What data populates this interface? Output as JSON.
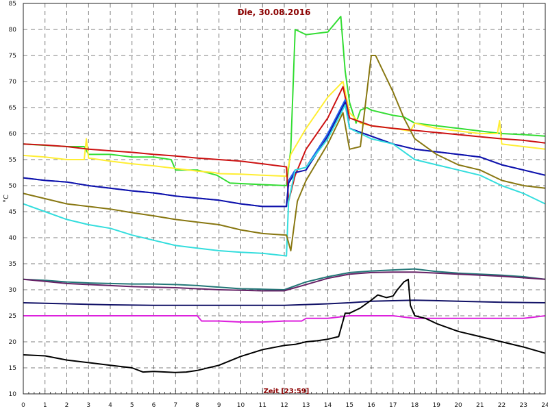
{
  "chart_data": {
    "type": "line",
    "title": "Die, 30.08.2016",
    "xlabel": "Zeit [23:59]",
    "ylabel": "°C",
    "xlim": [
      0,
      24
    ],
    "ylim": [
      10,
      85
    ],
    "xticks": [
      "0",
      "1",
      "2",
      "3",
      "4",
      "5",
      "6",
      "7",
      "8",
      "9",
      "10",
      "11",
      "12",
      "13",
      "14",
      "15",
      "16",
      "17",
      "18",
      "19",
      "20",
      "21",
      "22",
      "23",
      "24"
    ],
    "yticks": [
      "10",
      "15",
      "20",
      "25",
      "30",
      "35",
      "40",
      "45",
      "50",
      "55",
      "60",
      "65",
      "70",
      "75",
      "80",
      "85"
    ],
    "grid": true,
    "legend": "none",
    "series": [
      {
        "color": "#33dd33",
        "x": [
          0,
          2,
          2.8,
          3,
          4,
          5,
          6,
          6.8,
          7,
          8,
          8.9,
          9.5,
          11,
          12.1,
          12.3,
          12.5,
          13,
          14,
          14.6,
          14.8,
          15,
          15.3,
          15.5,
          15.8,
          16,
          17,
          17.5,
          18,
          19,
          20,
          21,
          22,
          23,
          24
        ],
        "y": [
          58,
          57.5,
          57.5,
          56,
          56,
          55.5,
          55.5,
          55,
          53,
          53,
          52,
          50.5,
          50.2,
          50,
          57,
          80,
          79,
          79.5,
          82.5,
          72,
          66,
          62,
          64.5,
          65,
          64.5,
          63.5,
          63.2,
          62,
          61.5,
          61,
          60.5,
          60,
          59.8,
          59.5
        ]
      },
      {
        "color": "#ffee33",
        "x": [
          0,
          1,
          2,
          2.8,
          2.9,
          3,
          4,
          5,
          6,
          7,
          8,
          8.8,
          9,
          10,
          11,
          12.1,
          12.3,
          13,
          14,
          14.7,
          15,
          15.5,
          16,
          17,
          17.8,
          18,
          19,
          20,
          21,
          21.8,
          21.9,
          22,
          23,
          24
        ],
        "y": [
          55.8,
          55.5,
          55,
          55,
          59,
          55.3,
          54.7,
          54.2,
          53.8,
          53.3,
          52.8,
          52.5,
          52.3,
          52.2,
          52,
          51.8,
          56,
          61,
          67,
          70,
          64,
          62,
          61.5,
          61,
          60.5,
          62,
          61,
          60.5,
          60,
          60,
          62.5,
          58,
          57.5,
          57
        ]
      },
      {
        "color": "#cc1111",
        "x": [
          0,
          1,
          2,
          3,
          4,
          5,
          6,
          7,
          8,
          9,
          10,
          11,
          12.1,
          12.2,
          12.5,
          13,
          14,
          14.7,
          15,
          16,
          17,
          18,
          19,
          20,
          21,
          22,
          23,
          24
        ],
        "y": [
          58,
          57.8,
          57.5,
          57,
          56.7,
          56.4,
          56,
          55.7,
          55.3,
          55,
          54.7,
          54.2,
          53.6,
          47,
          52,
          57,
          63,
          69,
          63,
          61.5,
          61,
          60.6,
          60.2,
          59.8,
          59.4,
          59,
          58.7,
          58.2
        ]
      },
      {
        "color": "#2266ee",
        "x": [
          0,
          1,
          2,
          3,
          4,
          5,
          6,
          7,
          8,
          9,
          10,
          11,
          12.1,
          12.2,
          12.5,
          13,
          14,
          14.8,
          15,
          16,
          17,
          18,
          19,
          20,
          21,
          22,
          23,
          24
        ],
        "y": [
          51.5,
          51,
          50.7,
          50,
          49.5,
          49,
          48.6,
          48,
          47.6,
          47.2,
          46.5,
          46,
          46,
          51,
          53,
          53.5,
          60,
          66.5,
          61,
          59.5,
          58,
          57,
          56.5,
          56,
          55.5,
          54,
          53,
          52
        ]
      },
      {
        "color": "#1111aa",
        "x": [
          0,
          1,
          2,
          3,
          4,
          5,
          6,
          7,
          8,
          9,
          10,
          11,
          12.1,
          12.2,
          12.5,
          13,
          14,
          14.8,
          15,
          16,
          17,
          18,
          19,
          20,
          21,
          22,
          23,
          24
        ],
        "y": [
          51.5,
          51,
          50.7,
          50,
          49.5,
          49,
          48.6,
          48,
          47.6,
          47.2,
          46.5,
          46,
          46,
          50.5,
          52.5,
          53,
          59.5,
          66,
          61,
          59.5,
          58,
          57,
          56.5,
          56,
          55.5,
          54,
          53,
          52
        ]
      },
      {
        "color": "#33dddd",
        "x": [
          0,
          1,
          2,
          3,
          4,
          5,
          6,
          7,
          8,
          9,
          10,
          11,
          12.1,
          12.2,
          12.5,
          13,
          14,
          14.8,
          15,
          16,
          17,
          17.5,
          18,
          19,
          20,
          21,
          22,
          23,
          24
        ],
        "y": [
          46.5,
          45,
          43.5,
          42.5,
          41.8,
          40.5,
          39.5,
          38.5,
          38,
          37.5,
          37.2,
          37,
          36.5,
          47,
          53,
          53.5,
          59,
          65.5,
          61,
          59,
          58,
          56.5,
          55,
          54,
          53,
          52,
          50,
          48.5,
          46.5
        ]
      },
      {
        "color": "#887711",
        "x": [
          0,
          1,
          2,
          3,
          4,
          5,
          6,
          7,
          8,
          9,
          10,
          11,
          12.1,
          12.3,
          12.6,
          13,
          14,
          14.7,
          15,
          15.5,
          16,
          16.2,
          17,
          17.5,
          18,
          19,
          20,
          21,
          22,
          23,
          24
        ],
        "y": [
          48.5,
          47.5,
          46.5,
          46,
          45.5,
          44.8,
          44.2,
          43.5,
          43,
          42.5,
          41.5,
          40.8,
          40.5,
          37.5,
          47,
          51,
          58,
          64,
          57,
          57.5,
          75,
          75,
          68,
          63,
          59,
          56,
          54,
          53,
          51,
          50,
          49.5
        ]
      },
      {
        "color": "#227777",
        "x": [
          0,
          1,
          2,
          3,
          4,
          5,
          6,
          7,
          8,
          9,
          10,
          11,
          12,
          13,
          14,
          15,
          16,
          17,
          18,
          19,
          20,
          21,
          22,
          23,
          24
        ],
        "y": [
          32,
          31.8,
          31.5,
          31.3,
          31.2,
          31.1,
          31.1,
          31,
          30.8,
          30.5,
          30.2,
          30.1,
          30,
          31.5,
          32.5,
          33.3,
          33.6,
          33.8,
          34,
          33.5,
          33.2,
          33,
          32.8,
          32.5,
          32
        ]
      },
      {
        "color": "#662266",
        "x": [
          0,
          1,
          2,
          3,
          4,
          5,
          6,
          7,
          8,
          9,
          10,
          11,
          12,
          13,
          14,
          15,
          16,
          17,
          18,
          19,
          20,
          21,
          22,
          23,
          24
        ],
        "y": [
          32,
          31.6,
          31.2,
          31,
          30.8,
          30.6,
          30.5,
          30.4,
          30.2,
          30,
          29.9,
          29.8,
          29.8,
          31,
          32.2,
          33,
          33.3,
          33.4,
          33.4,
          33.2,
          33,
          32.8,
          32.6,
          32.3,
          32
        ]
      },
      {
        "color": "#111166",
        "x": [
          0,
          2,
          4,
          6,
          8,
          10,
          12,
          14,
          15,
          16,
          18,
          20,
          22,
          24
        ],
        "y": [
          27.5,
          27.3,
          27.1,
          27,
          27,
          27,
          27,
          27.3,
          27.5,
          27.8,
          28,
          27.8,
          27.6,
          27.5
        ]
      },
      {
        "color": "#dd22dd",
        "x": [
          0,
          2,
          4,
          6,
          8,
          8.2,
          9,
          10,
          11,
          12,
          12.8,
          13,
          14,
          15,
          16,
          17,
          18,
          19,
          20,
          21,
          22,
          23,
          24
        ],
        "y": [
          25,
          25,
          25,
          25,
          25,
          24,
          24,
          23.8,
          23.8,
          24,
          24,
          24.5,
          24.5,
          25,
          25,
          25,
          24.5,
          24.5,
          24.5,
          24.5,
          24.5,
          24.5,
          25
        ]
      },
      {
        "color": "#000000",
        "x": [
          0,
          1,
          2,
          3,
          4,
          5,
          5.5,
          6,
          7,
          7.5,
          8,
          9,
          10,
          11,
          12,
          12.5,
          13,
          13.5,
          14,
          14.5,
          14.8,
          15,
          15.5,
          16,
          16.3,
          16.7,
          17,
          17.2,
          17.5,
          17.7,
          17.8,
          18,
          18.5,
          19,
          20,
          21,
          22,
          23,
          24
        ],
        "y": [
          17.5,
          17.3,
          16.5,
          16,
          15.5,
          15,
          14.2,
          14.3,
          14.1,
          14.2,
          14.5,
          15.5,
          17.2,
          18.5,
          19.3,
          19.5,
          20,
          20.2,
          20.5,
          21,
          25.5,
          25.5,
          26.5,
          28,
          29,
          28.5,
          28.8,
          30,
          31.5,
          32,
          27,
          25,
          24.5,
          23.5,
          22,
          21,
          20,
          19,
          17.8
        ]
      }
    ]
  }
}
